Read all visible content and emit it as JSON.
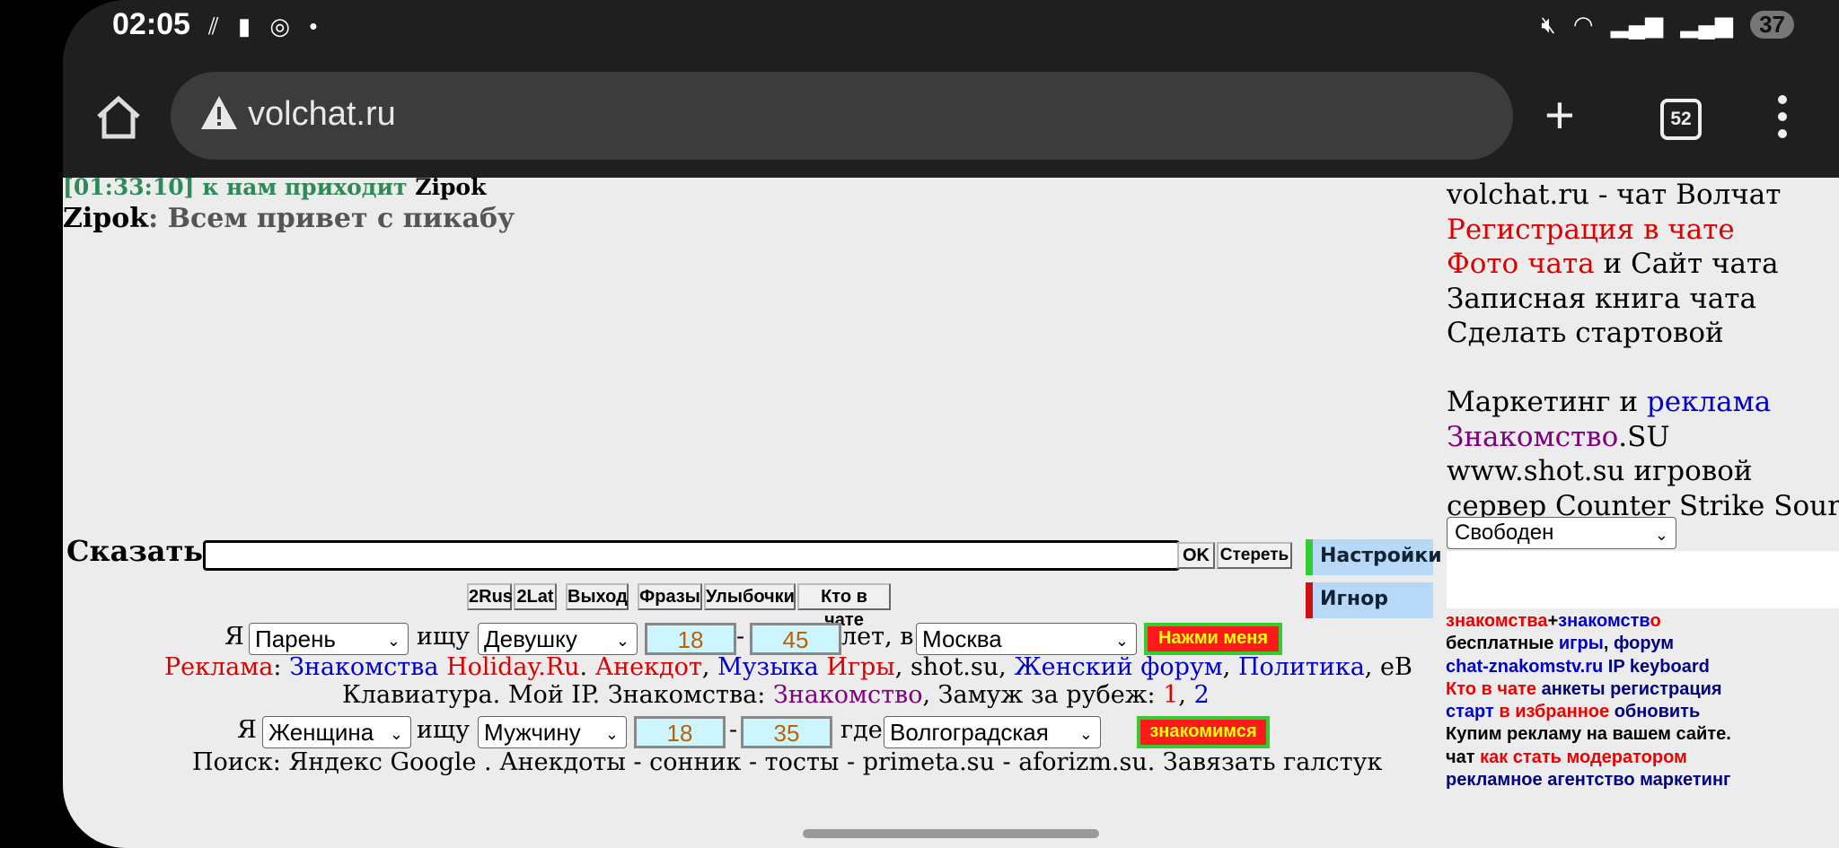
{
  "status_bar": {
    "time": "02:05",
    "battery": "37"
  },
  "browser": {
    "url": "volchat.ru",
    "tab_count": "52"
  },
  "chat": {
    "system_time": "[01:33:10]",
    "system_text": "к нам приходит",
    "system_user": "Zipok",
    "msg_user": "Zipok",
    "msg_text": "Всем привет с пикабу"
  },
  "sidebar": {
    "l1": "volchat.ru - чат Волчат",
    "l2": "Регистрация в чате",
    "l3a": "Фото чата",
    "l3b": "и",
    "l3c": "Сайт чата",
    "l4": "Записная книга чата",
    "l5": "Сделать стартовой",
    "l6a": "Маркетинг и",
    "l6b": "реклама",
    "l7a": "Знакомство",
    "l7b": ".SU",
    "l8a": "www.shot.su",
    "l8b": "игровой",
    "l9": "сервер Counter Strike Source",
    "status_select": "Свободен"
  },
  "sidelinks": {
    "a1": "знакомства",
    "a2": "+",
    "a3": "знакомств",
    "a4": "о",
    "b1": "бесплатные",
    "b2": "игры",
    "b3": ",",
    "b4": "форум",
    "c1": "chat-znakomstv.ru",
    "c2": "IP",
    "c3": "keyboard",
    "d1": "Кто в чате",
    "d2": "анкеты",
    "d3": "регистрация",
    "e1": "старт",
    "e2": "в избранное",
    "e3": "обновить",
    "f1": "Купим рекламу",
    "f2": "на вашем сайте.",
    "g1": "чат",
    "g2": "как стать модератором",
    "h1": "рекламное агентство",
    "h2": "маркетинг"
  },
  "say": {
    "label": "Сказать:",
    "ok": "OK",
    "clear": "Стереть",
    "settings": "Настройки",
    "ignore": "Игнор",
    "toolbar": [
      "2Rus",
      "2Lat",
      "Выход",
      "Фразы",
      "Улыбочки",
      "Кто в чате"
    ]
  },
  "search1": {
    "i": "Я",
    "gender": "Парень",
    "seek": "ищу",
    "target": "Девушку",
    "age_from": "18",
    "dash": "-",
    "age_to": "45",
    "years": "лет, в",
    "city": "Москва",
    "button": "Нажми меня"
  },
  "links1": {
    "r1": "Реклама",
    "colon": ":",
    "r2": "Знакомства",
    "r3": "Holiday.Ru",
    "dot": ".",
    "r4": "Анекдот",
    "r5": "Музыка",
    "r6": "Игры",
    "r7": "shot.su",
    "r8": "Женский форум",
    "r9": "Политика",
    "r10": "eB"
  },
  "links2": {
    "k1": "Клавиатура",
    "k2": "Мой IP",
    "k3": ". Знакомства:",
    "k4": "Знакомство",
    "k5": ", Замуж за рубеж:",
    "k6": "1",
    "k7": "2"
  },
  "search2": {
    "i": "Я",
    "gender": "Женщина",
    "seek": "ищу",
    "target": "Мужчину",
    "age_from": "18",
    "dash": "-",
    "age_to": "35",
    "where": "где",
    "city": "Волгоградская",
    "button": "знакомимся"
  },
  "links3": {
    "p1": "Поиск:",
    "p2": "Яндекс",
    "p3": "Google",
    "p4": "Анекдоты",
    "p5": "сонник",
    "p6": "тосты",
    "p7": "primeta.su",
    "p8": "aforizm.su",
    "p9": "Завязать галстук"
  }
}
